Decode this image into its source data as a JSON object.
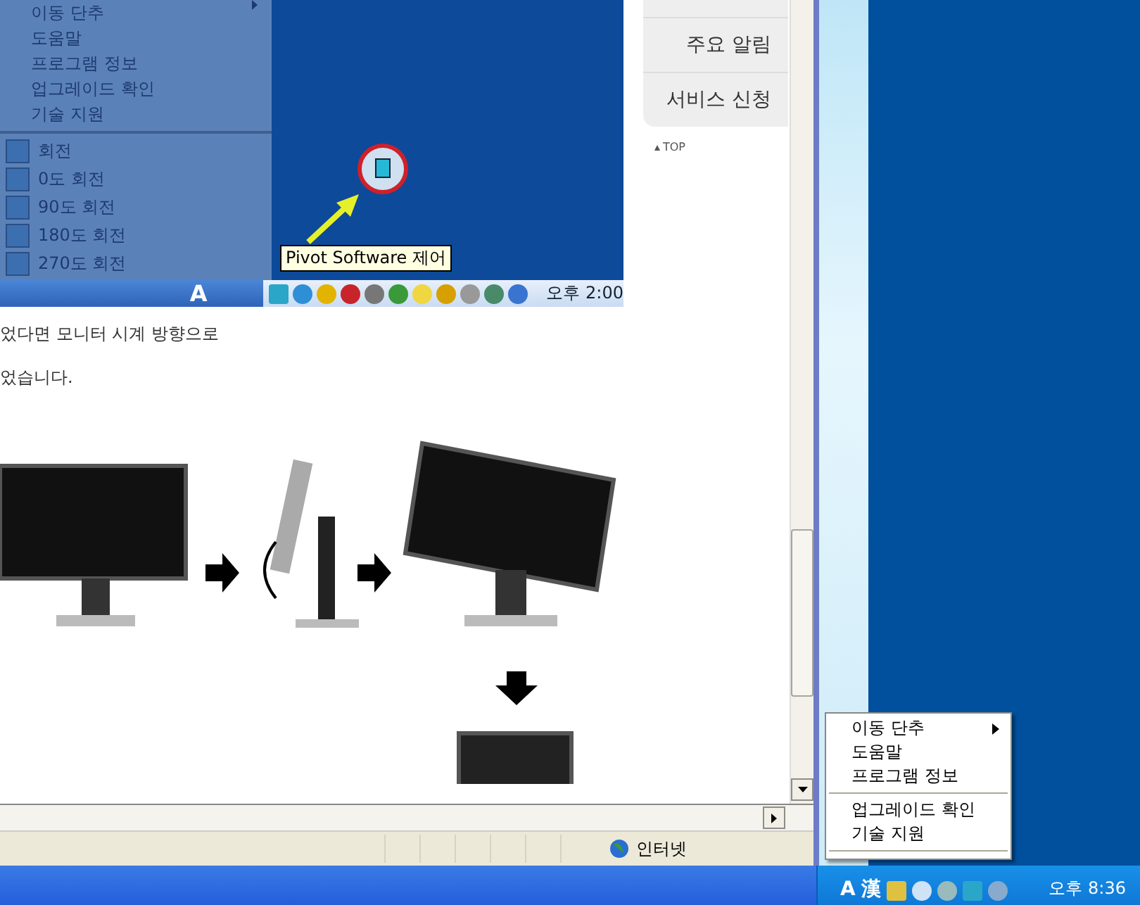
{
  "browser": {
    "page": {
      "screenshot": {
        "menu_items": [
          {
            "label": "이동 단추",
            "submenu": true
          },
          {
            "label": "도움말",
            "submenu": false
          },
          {
            "label": "프로그램 정보",
            "submenu": false
          },
          {
            "label": "업그레이드 확인",
            "submenu": false
          },
          {
            "label": "기술 지원",
            "submenu": false
          }
        ],
        "rotation_items": [
          "회전",
          "0도 회전",
          "90도 회전",
          "180도 회전",
          "270도 회전"
        ],
        "ime": "A",
        "tooltip": "Pivot Software 제어",
        "clock": "오후 2:00"
      },
      "sidebar": {
        "links": [
          "주요 알림",
          "서비스 신청"
        ],
        "top_link": "TOP"
      },
      "paragraph_lines": [
        "었다면 모니터 시계 방향으로",
        "었습니다."
      ]
    },
    "status_bar": {
      "zone": "인터넷"
    }
  },
  "context_menu": {
    "items": [
      {
        "kind": "item",
        "label": "이동 단추",
        "submenu": true
      },
      {
        "kind": "item",
        "label": "도움말",
        "submenu": false
      },
      {
        "kind": "item",
        "label": "프로그램 정보",
        "submenu": false
      },
      {
        "kind": "separator"
      },
      {
        "kind": "item",
        "label": "업그레이드 확인",
        "submenu": false
      },
      {
        "kind": "item",
        "label": "기술 지원",
        "submenu": false
      },
      {
        "kind": "separator"
      }
    ]
  },
  "taskbar": {
    "ime_mode": "A",
    "ime_hanja": "漢",
    "clock": "오후 8:36"
  }
}
